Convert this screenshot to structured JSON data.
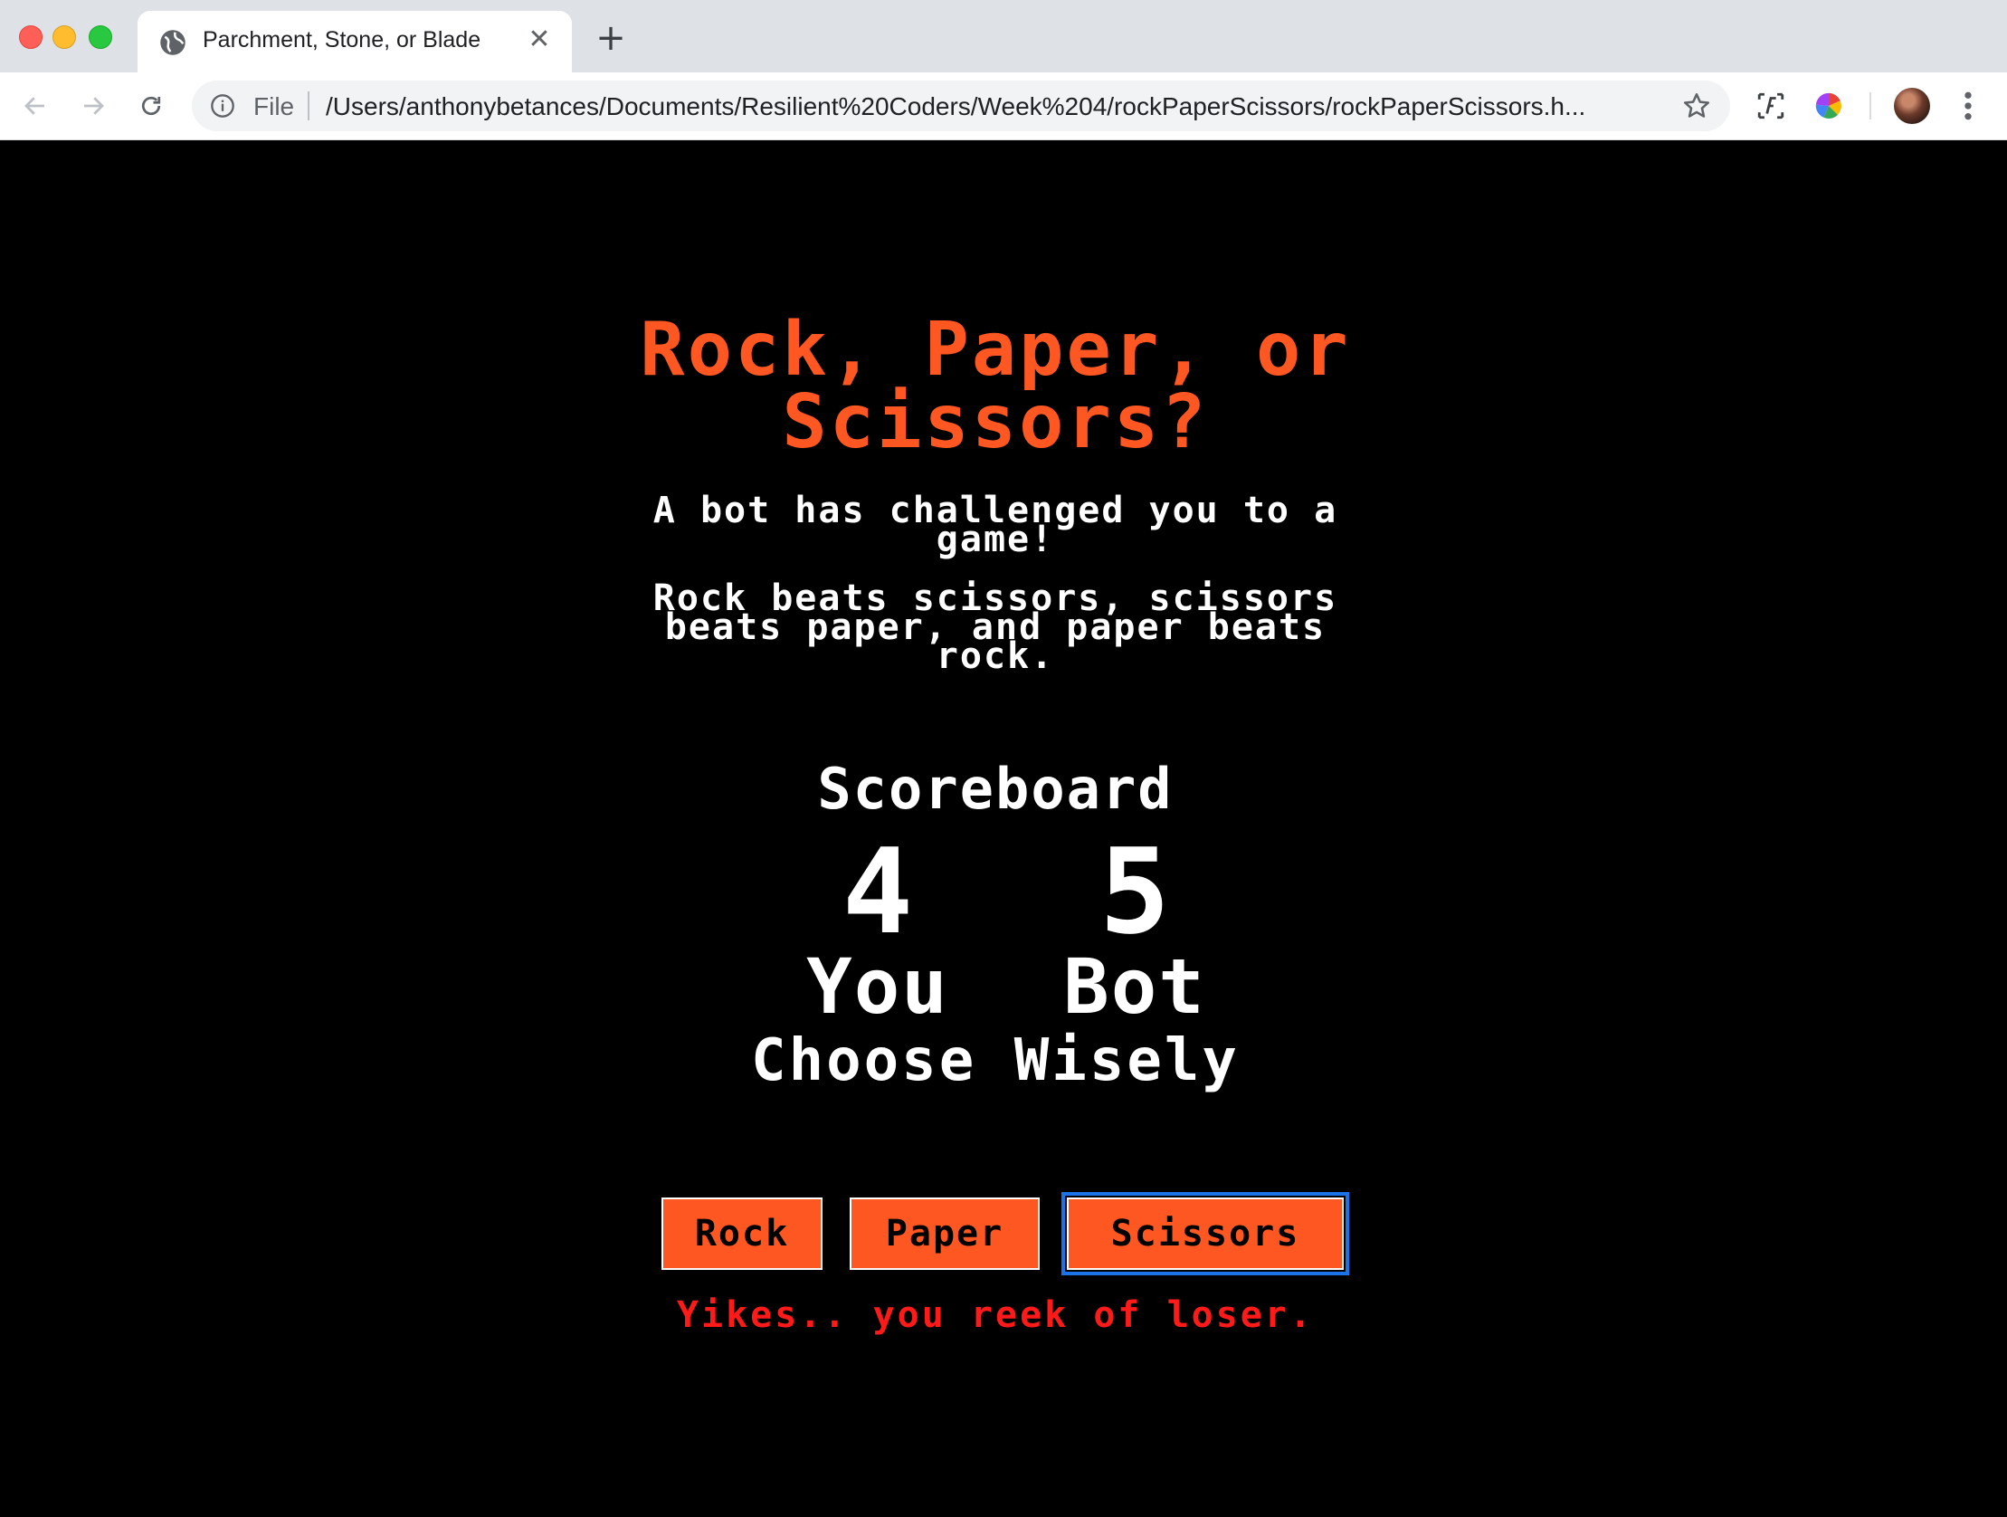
{
  "browser": {
    "tab_title": "Parchment, Stone, or Blade",
    "scheme_label": "File",
    "url": "/Users/anthonybetances/Documents/Resilient%20Coders/Week%204/rockPaperScissors/rockPaperScissors.h..."
  },
  "page": {
    "title_line1": "Rock, Paper, or",
    "title_line2": "Scissors?",
    "subtitle_line1": "A bot has challenged you to a",
    "subtitle_line2": "game!",
    "rules_line1": "Rock beats scissors, scissors",
    "rules_line2": "beats paper, and paper beats",
    "rules_line3": "rock.",
    "scoreboard_label": "Scoreboard",
    "player_score": "4",
    "bot_score": "5",
    "player_label": "You",
    "bot_label": "Bot",
    "prompt": "Choose Wisely",
    "buttons": {
      "rock": "Rock",
      "paper": "Paper",
      "scissors": "Scissors"
    },
    "result_message": "Yikes.. you reek of loser."
  },
  "colors": {
    "accent": "#ff5722",
    "result": "#ff1a1a",
    "background": "#000000"
  }
}
